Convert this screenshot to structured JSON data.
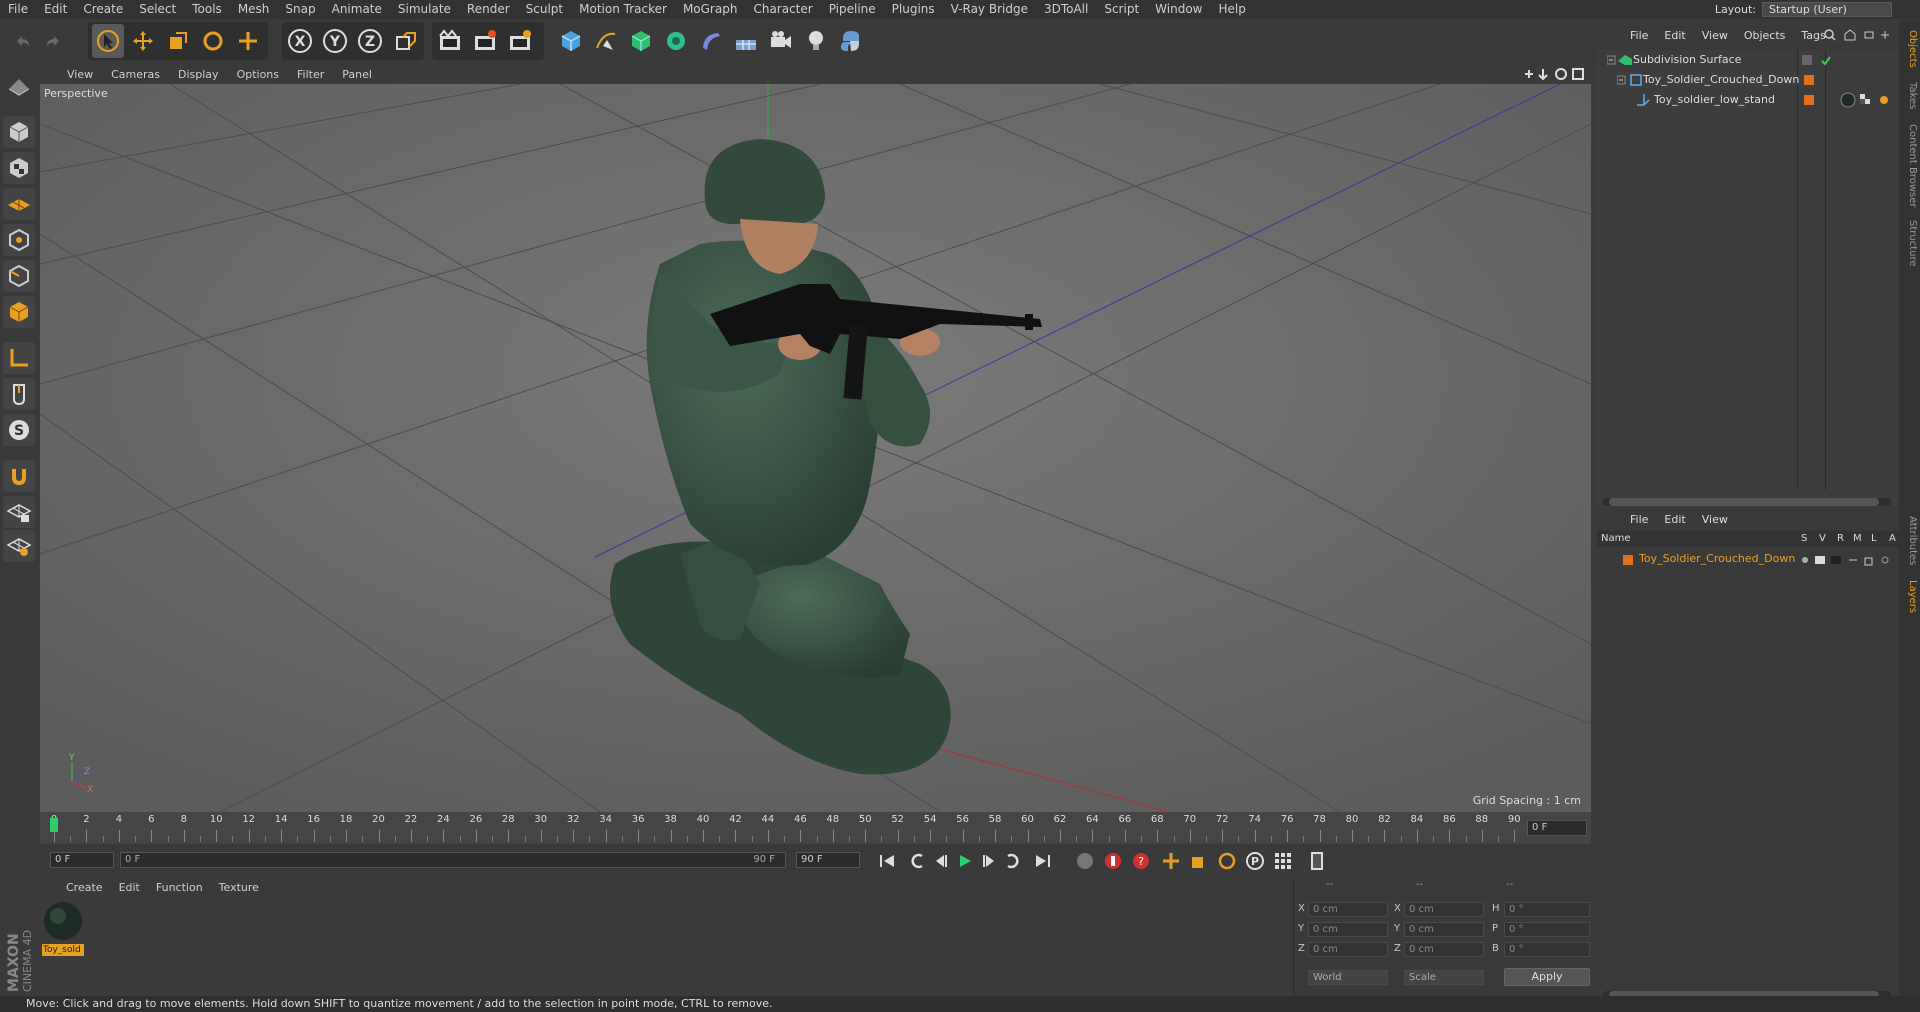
{
  "menubar": {
    "items": [
      "File",
      "Edit",
      "Create",
      "Select",
      "Tools",
      "Mesh",
      "Snap",
      "Animate",
      "Simulate",
      "Render",
      "Sculpt",
      "Motion Tracker",
      "MoGraph",
      "Character",
      "Pipeline",
      "Plugins",
      "V-Ray Bridge",
      "3DToAll",
      "Script",
      "Window",
      "Help"
    ],
    "layout_label": "Layout:",
    "layout_value": "Startup (User)"
  },
  "toolbar": {
    "axis_x": "X",
    "axis_y": "Y",
    "axis_z": "Z"
  },
  "viewport": {
    "menu": [
      "View",
      "Cameras",
      "Display",
      "Options",
      "Filter",
      "Panel"
    ],
    "label": "Perspective",
    "grid_spacing": "Grid Spacing : 1 cm",
    "axis_labels": {
      "y": "Y",
      "z": "Z",
      "x": "X"
    }
  },
  "timeline": {
    "ticks": [
      "0",
      "2",
      "4",
      "6",
      "8",
      "10",
      "12",
      "14",
      "16",
      "18",
      "20",
      "22",
      "24",
      "26",
      "28",
      "30",
      "32",
      "34",
      "36",
      "38",
      "40",
      "42",
      "44",
      "46",
      "48",
      "50",
      "52",
      "54",
      "56",
      "58",
      "60",
      "62",
      "64",
      "66",
      "68",
      "70",
      "72",
      "74",
      "76",
      "78",
      "80",
      "82",
      "84",
      "86",
      "88",
      "90"
    ],
    "current_frame": "0 F",
    "start_frame": "0 F",
    "range_start": "0 F",
    "range_end": "90 F",
    "end_frame": "90 F"
  },
  "material_manager": {
    "menu": [
      "Create",
      "Edit",
      "Function",
      "Texture"
    ],
    "material_name": "Toy_sold"
  },
  "coordinates": {
    "header_dashes": [
      "--",
      "--",
      "--"
    ],
    "rows": [
      {
        "l1": "X",
        "v1": "0 cm",
        "l2": "X",
        "v2": "0 cm",
        "l3": "H",
        "v3": "0 °"
      },
      {
        "l1": "Y",
        "v1": "0 cm",
        "l2": "Y",
        "v2": "0 cm",
        "l3": "P",
        "v3": "0 °"
      },
      {
        "l1": "Z",
        "v1": "0 cm",
        "l2": "Z",
        "v2": "0 cm",
        "l3": "B",
        "v3": "0 °"
      }
    ],
    "world": "World",
    "scale": "Scale",
    "apply": "Apply"
  },
  "object_manager": {
    "menu": [
      "File",
      "Edit",
      "View",
      "Objects",
      "Tags"
    ],
    "objects": [
      {
        "name": "Subdivision Surface",
        "indent": 0
      },
      {
        "name": "Toy_Soldier_Crouched_Down",
        "indent": 1
      },
      {
        "name": "Toy_soldier_low_stand",
        "indent": 2
      }
    ]
  },
  "layer_manager": {
    "menu": [
      "File",
      "Edit",
      "View"
    ],
    "columns": {
      "name": "Name",
      "s": "S",
      "v": "V",
      "r": "R",
      "m": "M",
      "l": "L",
      "a": "A"
    },
    "layers": [
      {
        "name": "Toy_Soldier_Crouched_Down",
        "color": "#e07020"
      }
    ]
  },
  "right_tabs": [
    "Objects",
    "Takes",
    "Content Browser",
    "Structure",
    "Attributes",
    "Layers"
  ],
  "logo": {
    "line1": "MAXON",
    "line2": "CINEMA 4D"
  },
  "status": "Move: Click and drag to move elements. Hold down SHIFT to quantize movement / add to the selection in point mode, CTRL to remove.",
  "colors": {
    "accent": "#e8a020",
    "soldier": "#3e5a49",
    "viewport_bg": "#6b6b6b"
  }
}
